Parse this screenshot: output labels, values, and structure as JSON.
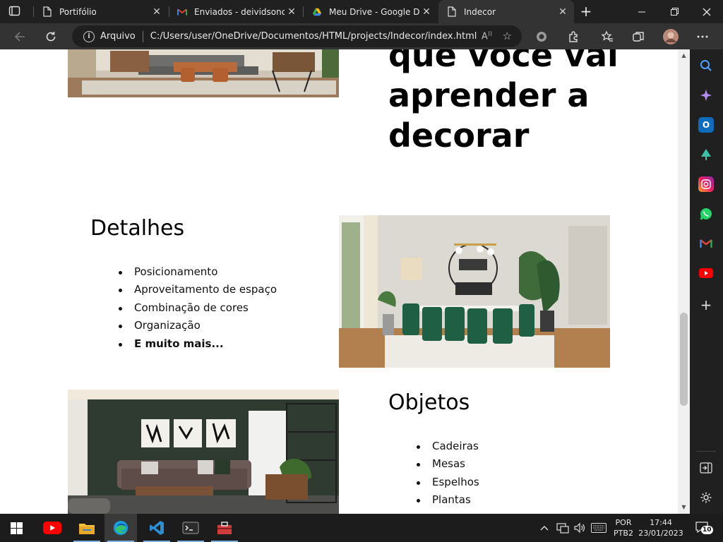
{
  "browser": {
    "tabs": [
      {
        "label": "Portifólio",
        "icon": "page-icon",
        "active": false
      },
      {
        "label": "Enviados - deividsonorn",
        "icon": "gmail-icon",
        "active": false
      },
      {
        "label": "Meu Drive - Google Drive",
        "icon": "google-drive-icon",
        "active": false
      },
      {
        "label": "Indecor",
        "icon": "page-icon",
        "active": true
      }
    ],
    "address": {
      "scheme_label": "Arquivo",
      "url": "C:/Users/user/OneDrive/Documentos/HTML/projects/Indecor/index.html"
    }
  },
  "page": {
    "hero": {
      "heading_lines": [
        "que você vai",
        "aprender a",
        "decorar"
      ]
    },
    "detalhes": {
      "title": "Detalhes",
      "items": [
        {
          "text": "Posicionamento",
          "bold": false
        },
        {
          "text": "Aproveitamento de espaço",
          "bold": false
        },
        {
          "text": "Combinação de cores",
          "bold": false
        },
        {
          "text": "Organização",
          "bold": false
        },
        {
          "text": "E muito mais...",
          "bold": true
        }
      ]
    },
    "objetos": {
      "title": "Objetos",
      "items": [
        "Cadeiras",
        "Mesas",
        "Espelhos",
        "Plantas"
      ]
    }
  },
  "taskbar": {
    "language_top": "POR",
    "language_bottom": "PTB2",
    "time": "17:44",
    "date": "23/01/2023",
    "notification_count": "10"
  },
  "colors": {
    "chrome_dark": "#202020",
    "toolbar": "#333333",
    "accent_edge": "#1b75d0"
  }
}
